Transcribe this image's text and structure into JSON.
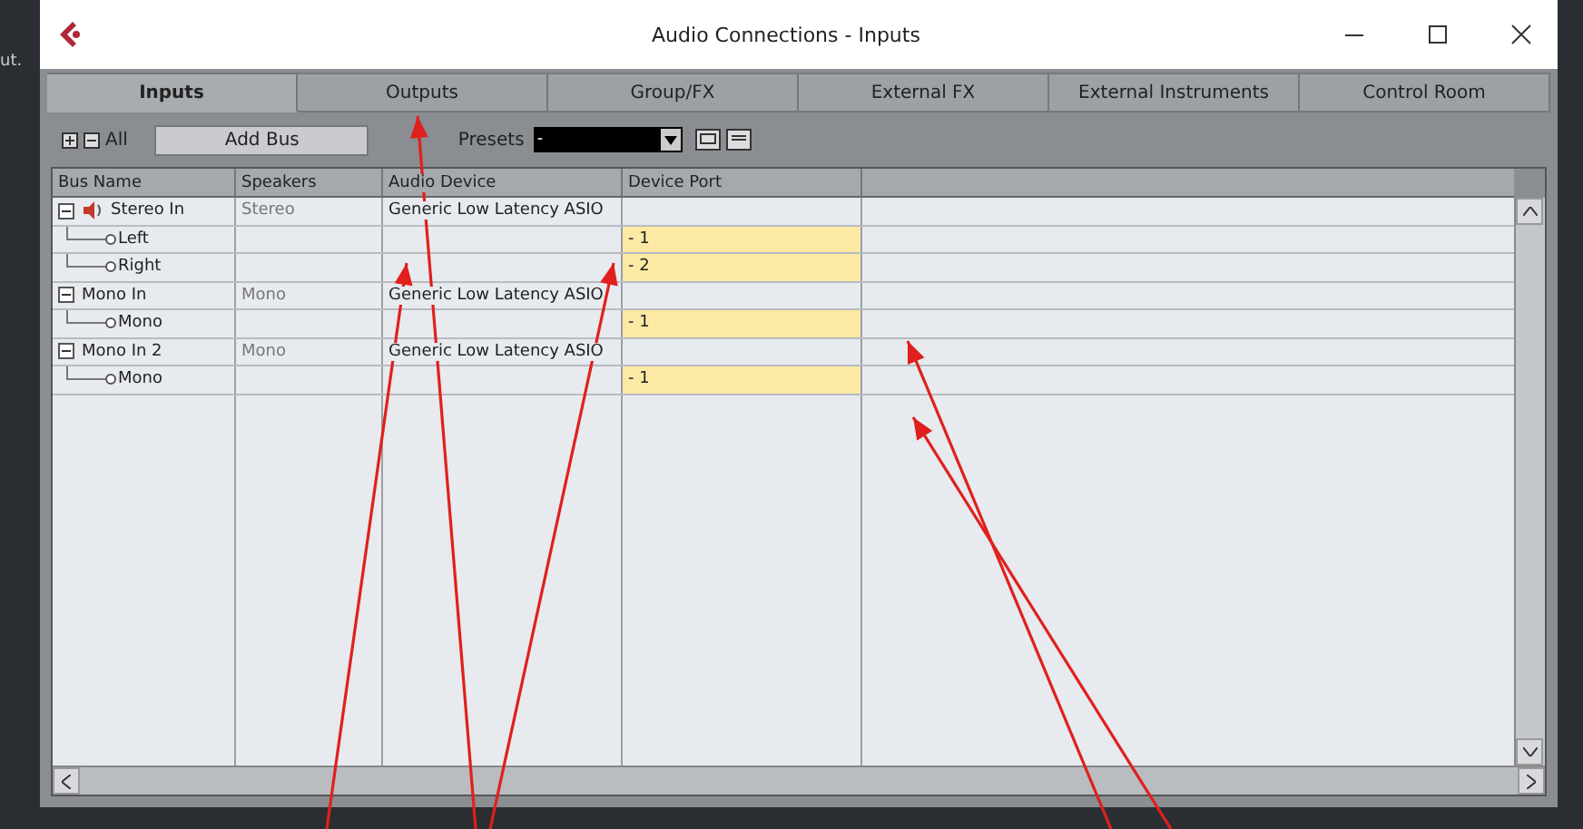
{
  "background_label": "ut.",
  "window": {
    "title": "Audio Connections - Inputs"
  },
  "tabs": [
    {
      "label": "Inputs",
      "selected": true
    },
    {
      "label": "Outputs",
      "selected": false
    },
    {
      "label": "Group/FX",
      "selected": false
    },
    {
      "label": "External FX",
      "selected": false
    },
    {
      "label": "External Instruments",
      "selected": false
    },
    {
      "label": "Control Room",
      "selected": false
    }
  ],
  "toolbar": {
    "expand_all": "All",
    "add_bus": "Add Bus",
    "presets_label": "Presets",
    "presets_value": "-"
  },
  "table": {
    "columns": [
      "Bus Name",
      "Speakers",
      "Audio Device",
      "Device Port"
    ],
    "buses": [
      {
        "name": "Stereo In",
        "speakers": "Stereo",
        "device": "Generic Low Latency ASIO",
        "expanded": true,
        "speaker_icon": true,
        "ports": [
          {
            "name": "Left",
            "port": "- 1"
          },
          {
            "name": "Right",
            "port": "- 2"
          }
        ]
      },
      {
        "name": "Mono In",
        "speakers": "Mono",
        "device": "Generic Low Latency ASIO",
        "expanded": true,
        "speaker_icon": false,
        "ports": [
          {
            "name": "Mono",
            "port": "- 1"
          }
        ]
      },
      {
        "name": "Mono In 2",
        "speakers": "Mono",
        "device": "Generic Low Latency ASIO",
        "expanded": true,
        "speaker_icon": false,
        "ports": [
          {
            "name": "Mono",
            "port": "- 1"
          }
        ]
      }
    ]
  }
}
